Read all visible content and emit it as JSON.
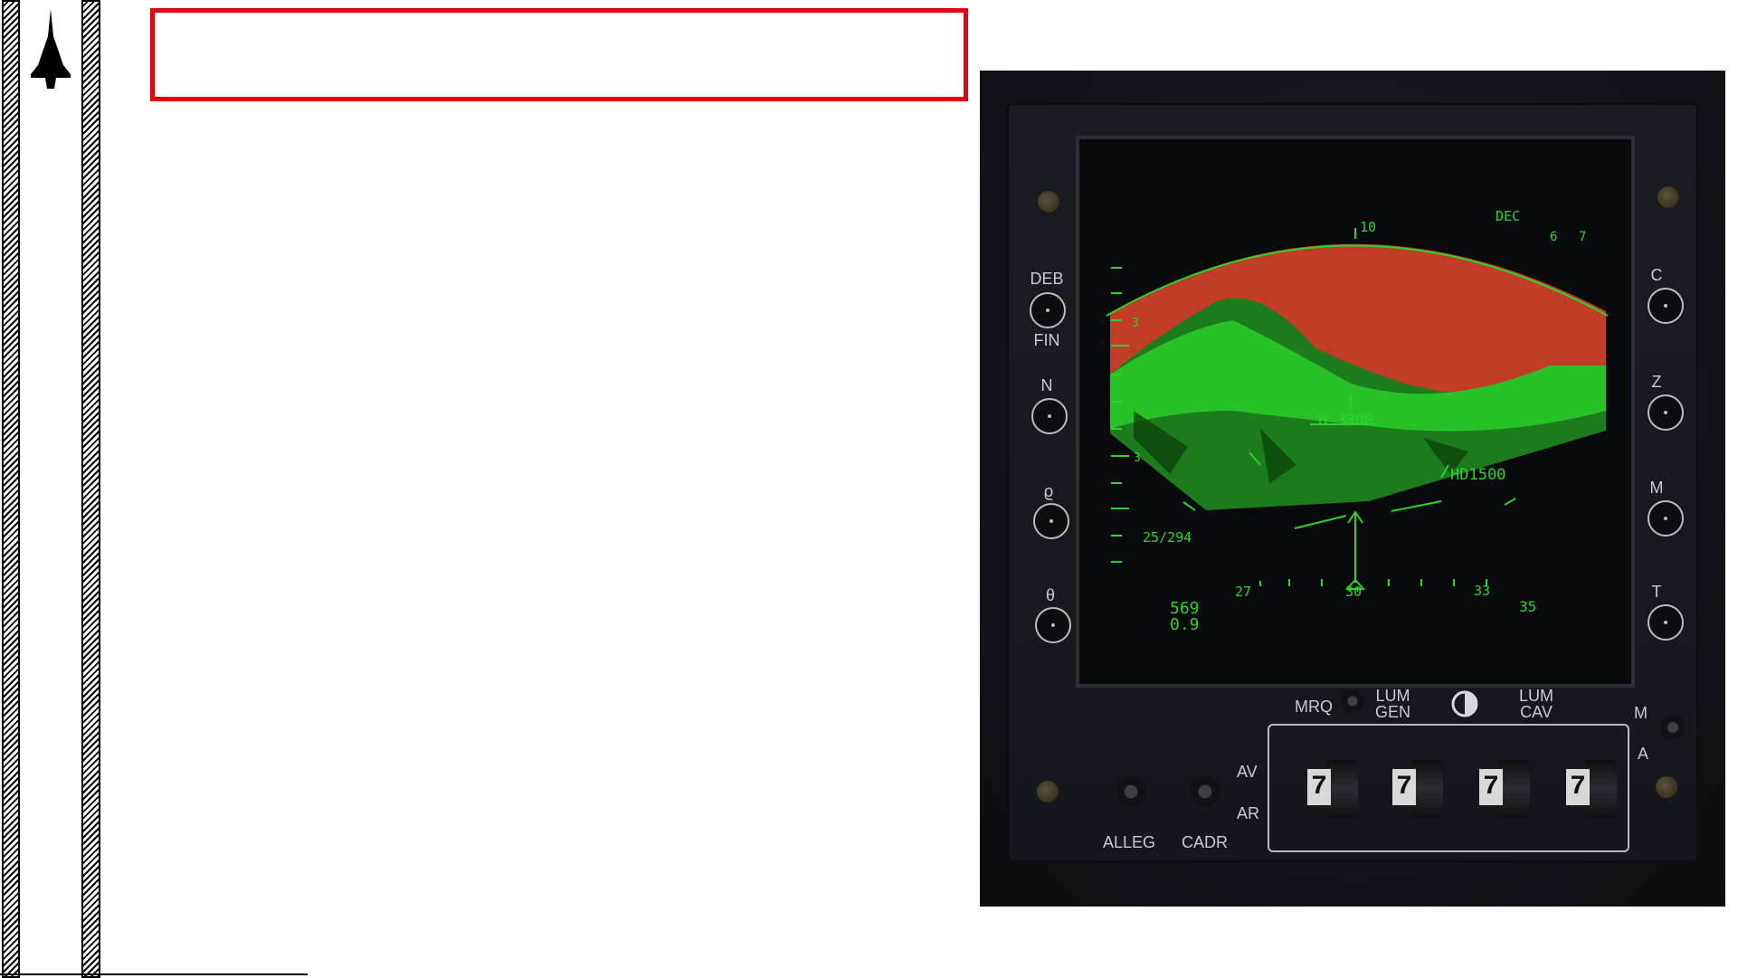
{
  "header": {
    "title": ""
  },
  "colors": {
    "accent_red": "#e8000f",
    "radar_green": "#2bd42b",
    "radar_red": "#d42a24"
  },
  "left_labels": [
    "DEB",
    "FIN",
    "N",
    "ϱ",
    "θ"
  ],
  "right_labels": [
    "C",
    "Z",
    "M",
    "T"
  ],
  "bottom": {
    "mrq": "MRQ",
    "lum_gen": [
      "LUM",
      "GEN"
    ],
    "lum_cav": [
      "LUM",
      "CAV"
    ],
    "m": "M",
    "a": "A",
    "av": "AV",
    "ar": "AR",
    "alleg": "ALLEG",
    "cadr": "CADR",
    "digits": [
      "7",
      "7",
      "7",
      "7"
    ]
  },
  "radar": {
    "dec": "DEC",
    "top_tick": "10",
    "right_tick_1": "6",
    "right_tick_2": "7",
    "left_tick": "3",
    "scale_3": "3",
    "altitude": "H  3300",
    "hd": "HD1500",
    "range": "25/294",
    "heading_27": "27",
    "heading_30": "30",
    "heading_33": "33",
    "heading_35": "35",
    "speed": "569",
    "mach": "0.9"
  }
}
